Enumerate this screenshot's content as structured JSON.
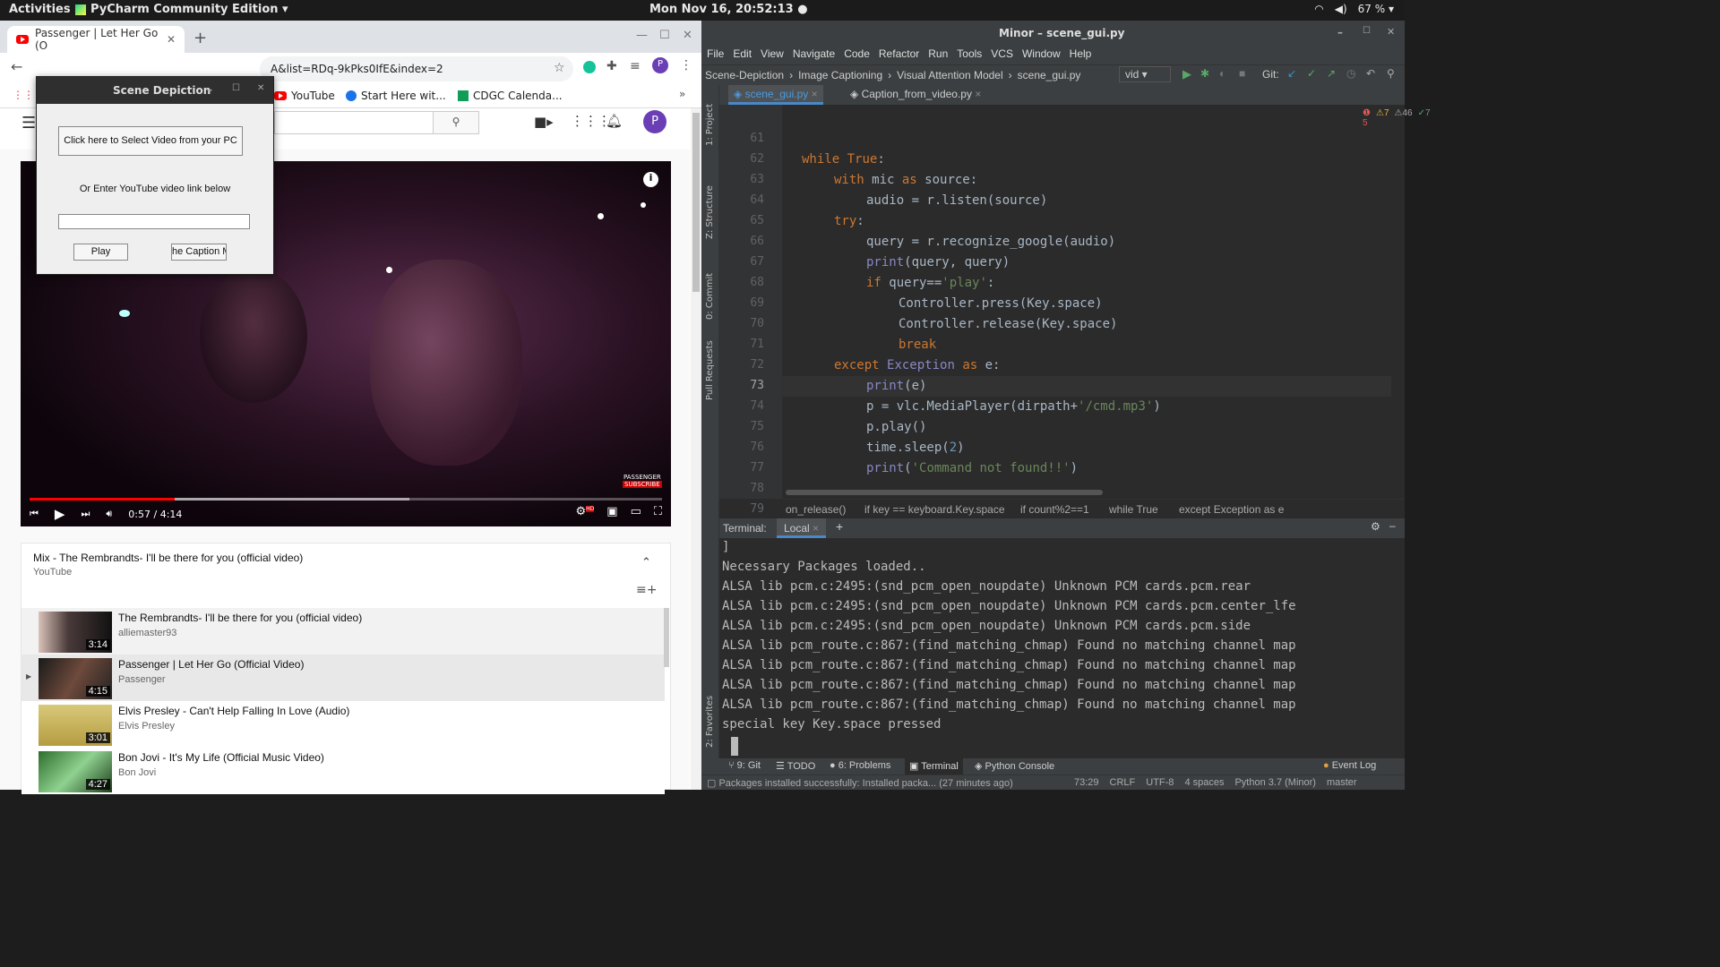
{
  "topbar": {
    "activities": "Activities",
    "app": "PyCharm Community Edition ▾",
    "clock": "Mon Nov 16, 20:52:13 ●",
    "wifi": "wifi-icon",
    "vol": "volume-icon",
    "battery": "67 % ▾"
  },
  "chrome": {
    "tab_title": "Passenger | Let Her Go (O",
    "url": "A&list=RDq-9kPks0IfE&index=2",
    "bookmarks": [
      "YouTube",
      "Start Here wit...",
      "CDGC Calenda..."
    ],
    "profile": "P"
  },
  "video": {
    "time": "0:57 / 4:14",
    "played_pct": 0.23,
    "buffered_pct": 0.6,
    "watermark": "PASSENGER",
    "subscribe": "SUBSCRIBE",
    "hd": "HD"
  },
  "playlist": {
    "title": "Mix - The Rembrandts- I'll be there for you (official video)",
    "source": "YouTube",
    "items": [
      {
        "title": "The Rembrandts- I'll be there for you (official video)",
        "channel": "alliemaster93",
        "duration": "3:14"
      },
      {
        "title": "Passenger | Let Her Go (Official Video)",
        "channel": "Passenger",
        "duration": "4:15",
        "marker": "▶"
      },
      {
        "title": "Elvis Presley - Can't Help Falling In Love (Audio)",
        "channel": "Elvis Presley",
        "duration": "3:01"
      },
      {
        "title": "Bon Jovi - It's My Life (Official Music Video)",
        "channel": "Bon Jovi",
        "duration": "4:27"
      }
    ]
  },
  "dialog": {
    "title": "Scene Depiction",
    "select_btn": "Click here to Select Video from your PC",
    "or_text": "Or Enter YouTube video link below",
    "link_value": "",
    "play_btn": "Play",
    "caption_btn": "he Caption M"
  },
  "pycharm": {
    "title": "Minor – scene_gui.py",
    "menu": [
      "File",
      "Edit",
      "View",
      "Navigate",
      "Code",
      "Refactor",
      "Run",
      "Tools",
      "VCS",
      "Window",
      "Help"
    ],
    "nav": [
      "Scene-Depiction",
      "Image Captioning",
      "Visual Attention Model",
      "scene_gui.py"
    ],
    "run_config": "vid",
    "git_label": "Git:",
    "tabs": [
      "scene_gui.py",
      "Caption_from_video.py"
    ],
    "inspections": {
      "errors": "5",
      "warnings": "7",
      "weak": "46",
      "ok": "7"
    },
    "line_numbers": [
      "61",
      "62",
      "63",
      "64",
      "65",
      "66",
      "67",
      "68",
      "69",
      "70",
      "71",
      "72",
      "73",
      "74",
      "75",
      "76",
      "77",
      "78",
      "79"
    ],
    "breadcrumbs": [
      "on_release()",
      "if key == keyboard.Key.space",
      "if count%2==1",
      "while True",
      "except Exception as e"
    ],
    "terminal_tabs": [
      "Terminal:",
      "Local"
    ],
    "terminal_lines": [
      "]",
      "Necessary Packages loaded..",
      "ALSA lib pcm.c:2495:(snd_pcm_open_noupdate) Unknown PCM cards.pcm.rear",
      "ALSA lib pcm.c:2495:(snd_pcm_open_noupdate) Unknown PCM cards.pcm.center_lfe",
      "ALSA lib pcm.c:2495:(snd_pcm_open_noupdate) Unknown PCM cards.pcm.side",
      "ALSA lib pcm_route.c:867:(find_matching_chmap) Found no matching channel map",
      "ALSA lib pcm_route.c:867:(find_matching_chmap) Found no matching channel map",
      "ALSA lib pcm_route.c:867:(find_matching_chmap) Found no matching channel map",
      "ALSA lib pcm_route.c:867:(find_matching_chmap) Found no matching channel map",
      "special key Key.space pressed"
    ],
    "tool_tabs": [
      "9: Git",
      "TODO",
      "6: Problems",
      "Terminal",
      "Python Console",
      "Event Log"
    ],
    "status_msg": "Packages installed successfully: Installed packa... (27 minutes ago)",
    "status_right": [
      "73:29",
      "CRLF",
      "UTF-8",
      "4 spaces",
      "Python 3.7 (Minor)",
      "master"
    ],
    "side_tabs": [
      "1: Project",
      "Z: Structure",
      "0: Commit",
      "Pull Requests",
      "2: Favorites"
    ]
  }
}
